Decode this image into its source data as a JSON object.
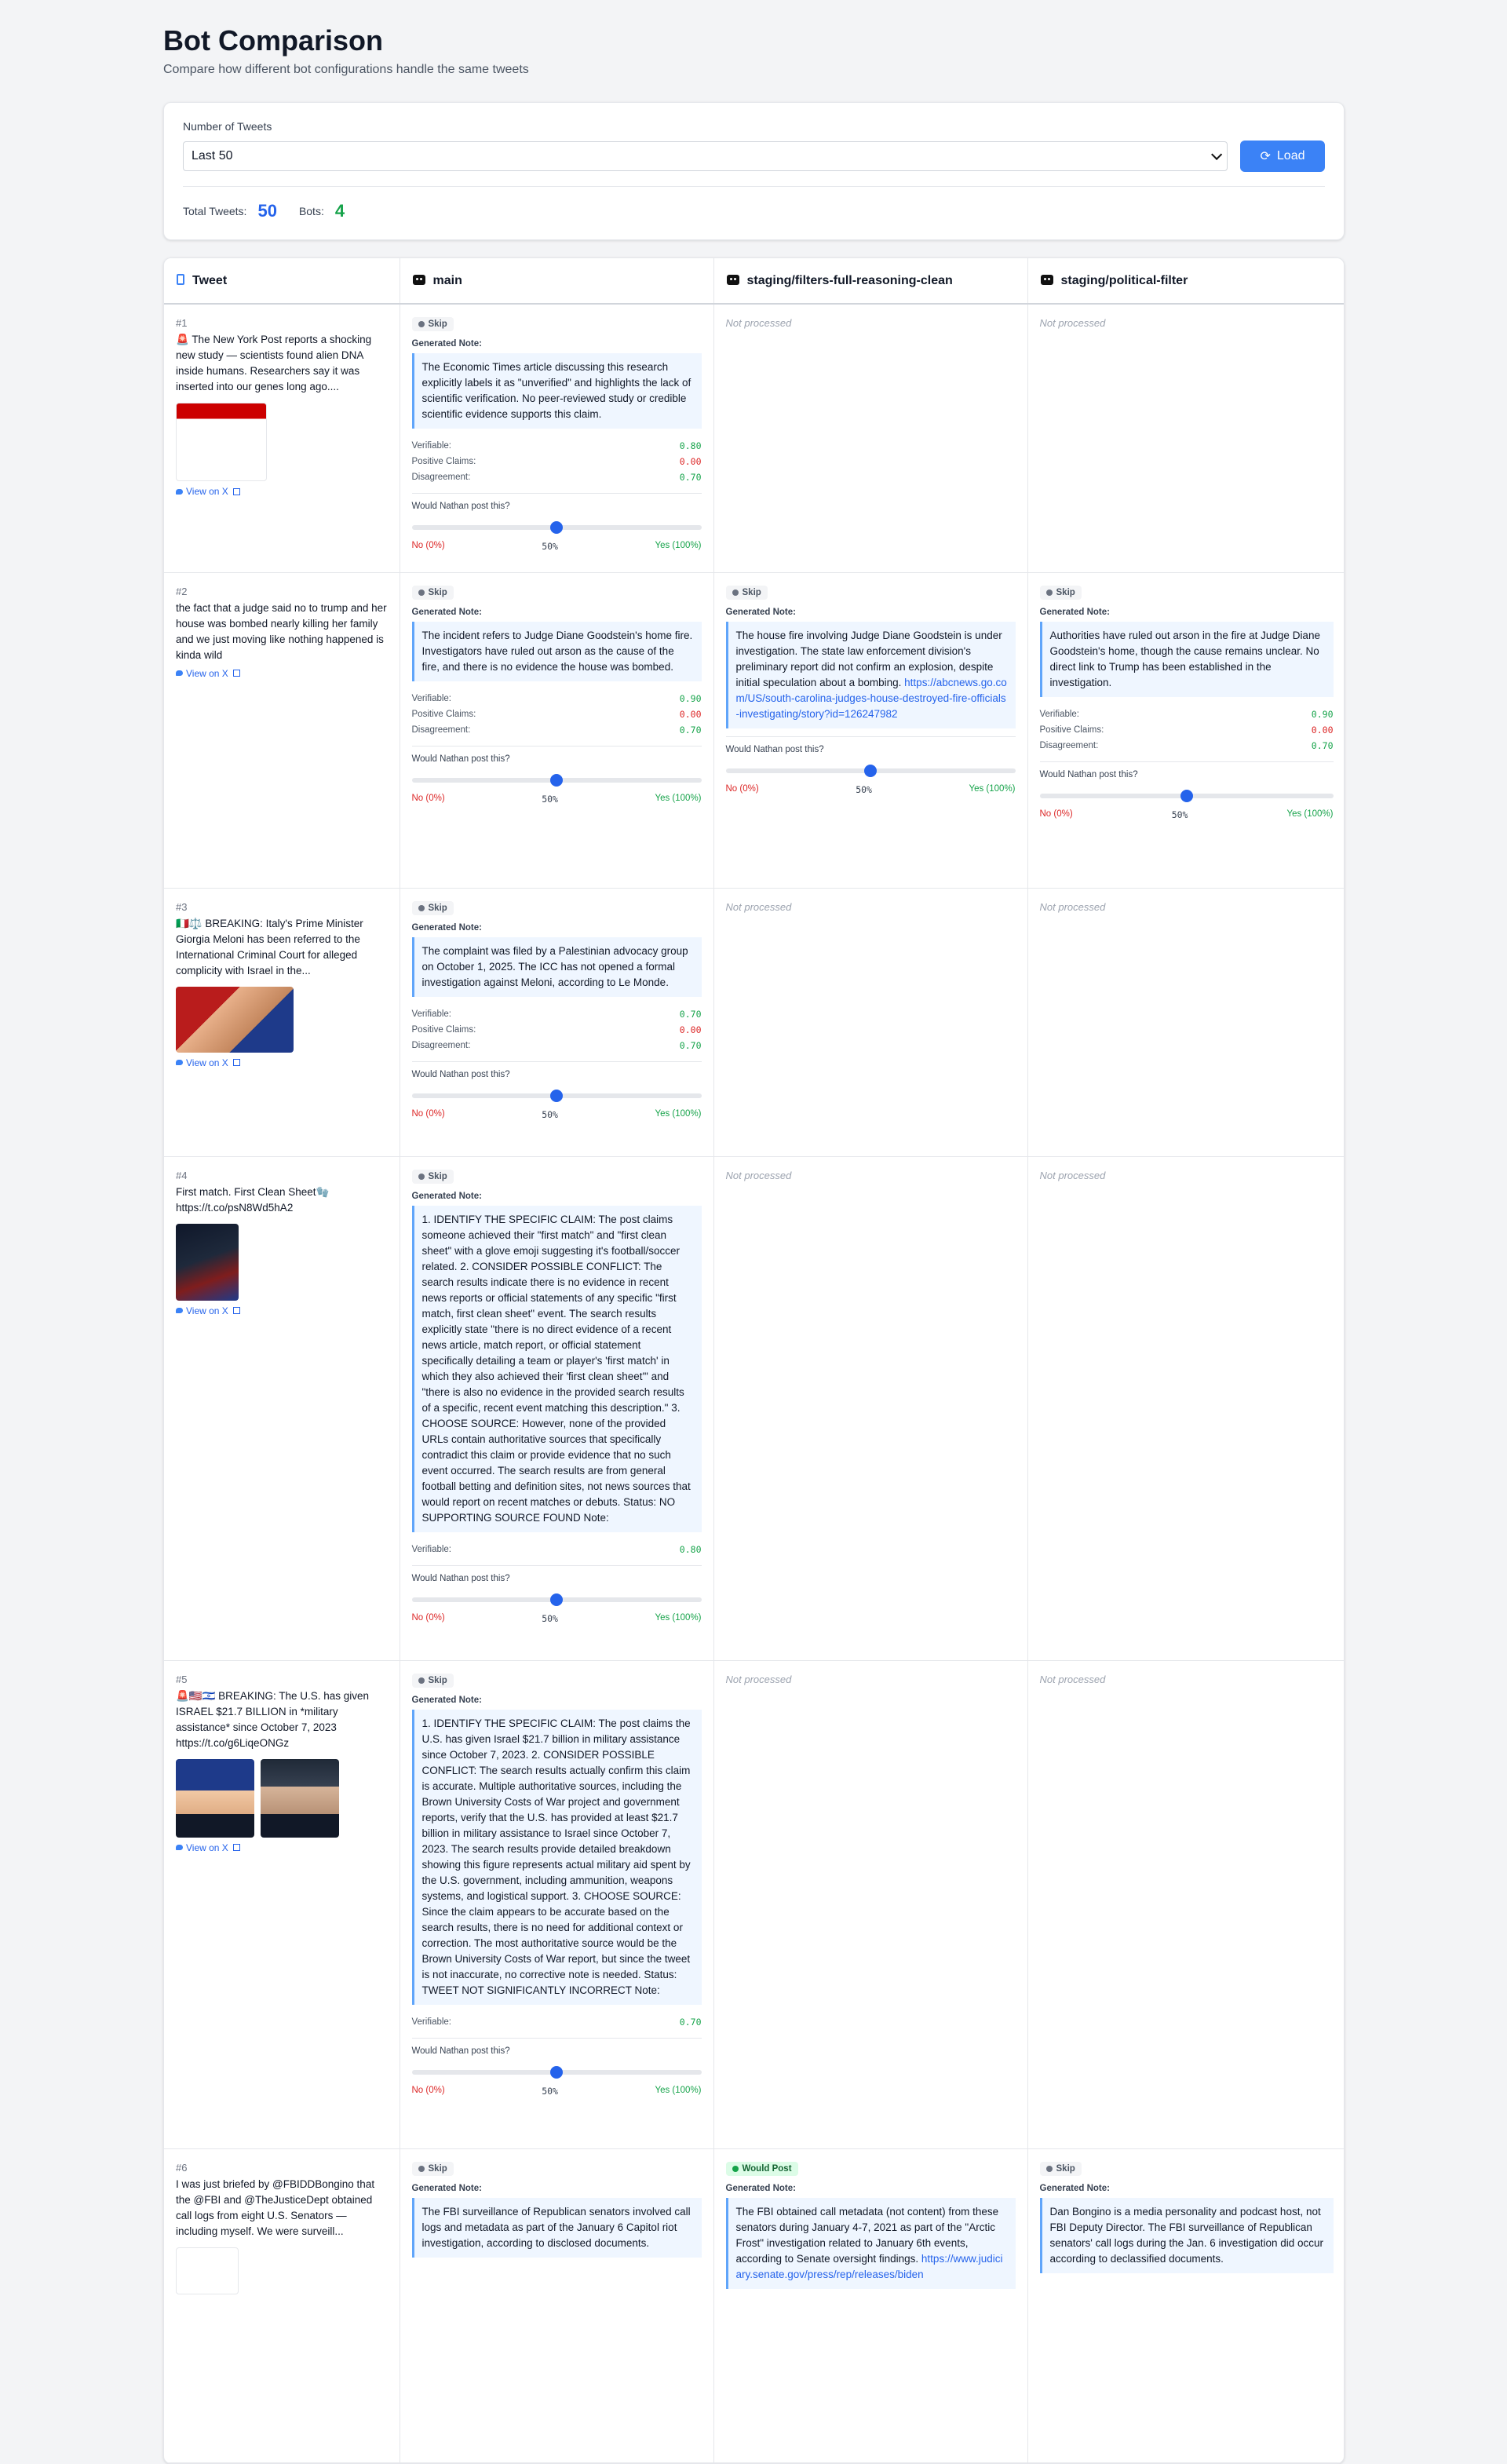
{
  "header": {
    "title": "Bot Comparison",
    "subtitle": "Compare how different bot configurations handle the same tweets"
  },
  "controls": {
    "label": "Number of Tweets",
    "selected": "Last 50",
    "load_label": "Load",
    "total_label": "Total Tweets:",
    "total_value": "50",
    "bots_label": "Bots:",
    "bots_value": "4"
  },
  "columns": {
    "tweet": "Tweet",
    "bot1": "main",
    "bot2": "staging/filters-full-reasoning-clean",
    "bot3": "staging/political-filter"
  },
  "common": {
    "skip": "Skip",
    "would_post": "Would Post",
    "generated_note": "Generated Note:",
    "verifiable": "Verifiable:",
    "positive": "Positive Claims:",
    "disagreement": "Disagreement:",
    "poll_q": "Would Nathan post this?",
    "no": "No (0%)",
    "mid": "50%",
    "yes": "Yes (100%)",
    "not_processed": "Not processed",
    "view_on_x": "View on X"
  },
  "rows": [
    {
      "num": "#1",
      "text": "🚨 The New York Post reports a shocking new study — scientists found alien DNA inside humans. Researchers say it was inserted into our genes long ago....",
      "main": {
        "note": "The Economic Times article discussing this research explicitly labels it as \"unverified\" and highlights the lack of scientific verification. No peer-reviewed study or credible scientific evidence supports this claim.",
        "v": "0.80",
        "p": "0.00",
        "d": "0.70"
      }
    },
    {
      "num": "#2",
      "text": "the fact that a judge said no to trump and her house was bombed nearly killing her family and we just moving like nothing happened is kinda wild",
      "main": {
        "note": "The incident refers to Judge Diane Goodstein's home fire. Investigators have ruled out arson as the cause of the fire, and there is no evidence the house was bombed.",
        "v": "0.90",
        "p": "0.00",
        "d": "0.70"
      },
      "bot2": {
        "note": "The house fire involving Judge Diane Goodstein is under investigation. The state law enforcement division's preliminary report did not confirm an explosion, despite initial speculation about a bombing.",
        "link": "https://abcnews.go.com/US/south-carolina-judges-house-destroyed-fire-officials-investigating/story?id=126247982"
      },
      "bot3": {
        "note": "Authorities have ruled out arson in the fire at Judge Diane Goodstein's home, though the cause remains unclear. No direct link to Trump has been established in the investigation.",
        "v": "0.90",
        "p": "0.00",
        "d": "0.70"
      }
    },
    {
      "num": "#3",
      "text": "🇮🇹⚖️ BREAKING: Italy's Prime Minister Giorgia Meloni has been referred to the International Criminal Court for alleged complicity with Israel in the...",
      "main": {
        "note": "The complaint was filed by a Palestinian advocacy group on October 1, 2025. The ICC has not opened a formal investigation against Meloni, according to Le Monde.",
        "v": "0.70",
        "p": "0.00",
        "d": "0.70"
      }
    },
    {
      "num": "#4",
      "text": "First match. First Clean Sheet🧤 https://t.co/psN8Wd5hA2",
      "main": {
        "note": "1. IDENTIFY THE SPECIFIC CLAIM: The post claims someone achieved their \"first match\" and \"first clean sheet\" with a glove emoji suggesting it's football/soccer related. 2. CONSIDER POSSIBLE CONFLICT: The search results indicate there is no evidence in recent news reports or official statements of any specific \"first match, first clean sheet\" event. The search results explicitly state \"there is no direct evidence of a recent news article, match report, or official statement specifically detailing a team or player's 'first match' in which they also achieved their 'first clean sheet'\" and \"there is also no evidence in the provided search results of a specific, recent event matching this description.\" 3. CHOOSE SOURCE: However, none of the provided URLs contain authoritative sources that specifically contradict this claim or provide evidence that no such event occurred. The search results are from general football betting and definition sites, not news sources that would report on recent matches or debuts. Status: NO SUPPORTING SOURCE FOUND Note:",
        "v": "0.80"
      }
    },
    {
      "num": "#5",
      "text": "🚨🇺🇸🇮🇱 BREAKING: The U.S. has given ISRAEL $21.7 BILLION in *military assistance* since October 7, 2023 https://t.co/g6LiqeONGz",
      "main": {
        "note": "1. IDENTIFY THE SPECIFIC CLAIM: The post claims the U.S. has given Israel $21.7 billion in military assistance since October 7, 2023. 2. CONSIDER POSSIBLE CONFLICT: The search results actually confirm this claim is accurate. Multiple authoritative sources, including the Brown University Costs of War project and government reports, verify that the U.S. has provided at least $21.7 billion in military assistance to Israel since October 7, 2023. The search results provide detailed breakdown showing this figure represents actual military aid spent by the U.S. government, including ammunition, weapons systems, and logistical support. 3. CHOOSE SOURCE: Since the claim appears to be accurate based on the search results, there is no need for additional context or correction. The most authoritative source would be the Brown University Costs of War report, but since the tweet is not inaccurate, no corrective note is needed. Status: TWEET NOT SIGNIFICANTLY INCORRECT Note:",
        "v": "0.70"
      }
    },
    {
      "num": "#6",
      "text": "I was just briefed by @FBIDDBongino that the @FBI and @TheJusticeDept obtained call logs from eight U.S. Senators — including myself. We were surveill...",
      "main": {
        "note": "The FBI surveillance of Republican senators involved call logs and metadata as part of the January 6 Capitol riot investigation, according to disclosed documents."
      },
      "bot2": {
        "note": "The FBI obtained call metadata (not content) from these senators during January 4-7, 2021 as part of the \"Arctic Frost\" investigation related to January 6th events, according to Senate oversight findings.",
        "link": "https://www.judiciary.senate.gov/press/rep/releases/biden"
      },
      "bot3": {
        "note": "Dan Bongino is a media personality and podcast host, not FBI Deputy Director. The FBI surveillance of Republican senators' call logs during the Jan. 6 investigation did occur according to declassified documents."
      }
    }
  ]
}
